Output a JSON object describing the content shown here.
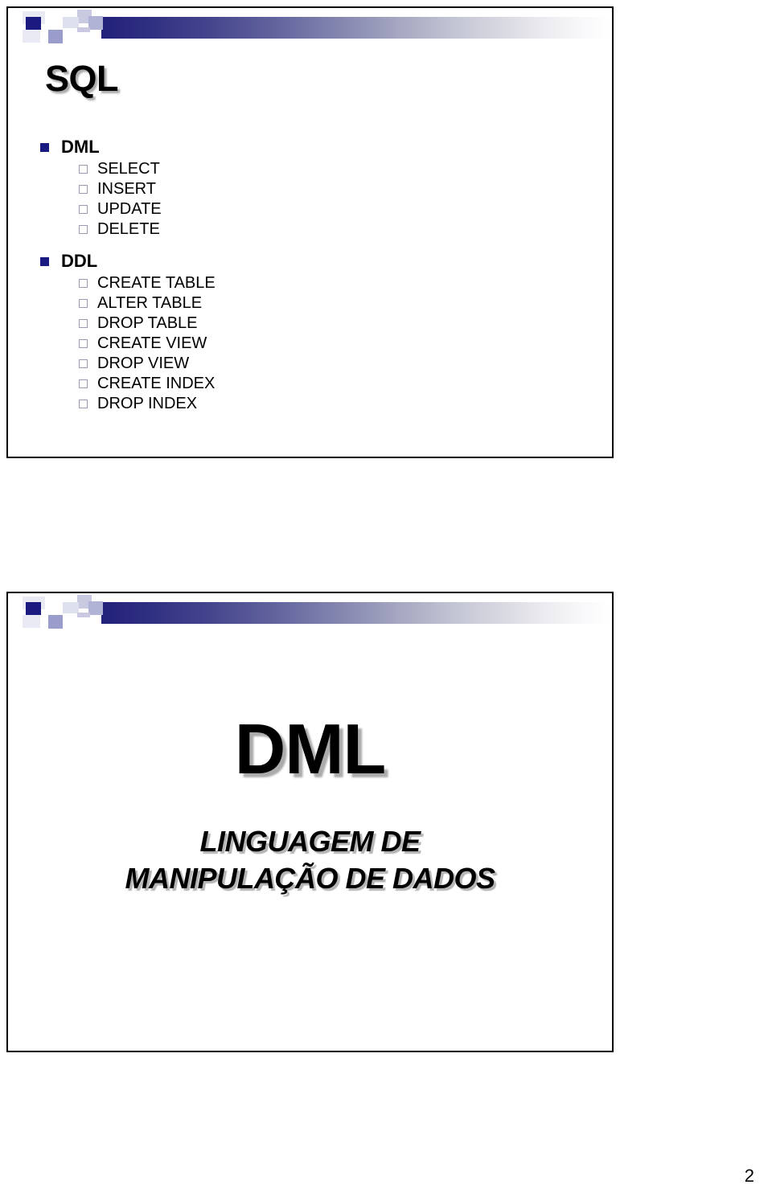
{
  "page": {
    "page_number": "2",
    "accent_navy": "#1a1a80",
    "gradient_start": "#22217a",
    "gradient_end": "#ffffff",
    "bullet_outline_color": "#9a9ab4"
  },
  "slide1": {
    "title": "SQL",
    "deco_icon": "decorative-squares",
    "groups": [
      {
        "label": "DML",
        "items": [
          {
            "label": "SELECT"
          },
          {
            "label": "INSERT"
          },
          {
            "label": "UPDATE"
          },
          {
            "label": "DELETE"
          }
        ]
      },
      {
        "label": "DDL",
        "items": [
          {
            "label": "CREATE TABLE"
          },
          {
            "label": "ALTER TABLE"
          },
          {
            "label": "DROP TABLE"
          },
          {
            "label": "CREATE VIEW"
          },
          {
            "label": "DROP VIEW"
          },
          {
            "label": "CREATE INDEX"
          },
          {
            "label": "DROP INDEX"
          }
        ]
      }
    ]
  },
  "slide2": {
    "deco_icon": "decorative-squares",
    "title": "DML",
    "subtitle_line1": "LINGUAGEM DE",
    "subtitle_line2": "MANIPULAÇÃO DE DADOS"
  }
}
